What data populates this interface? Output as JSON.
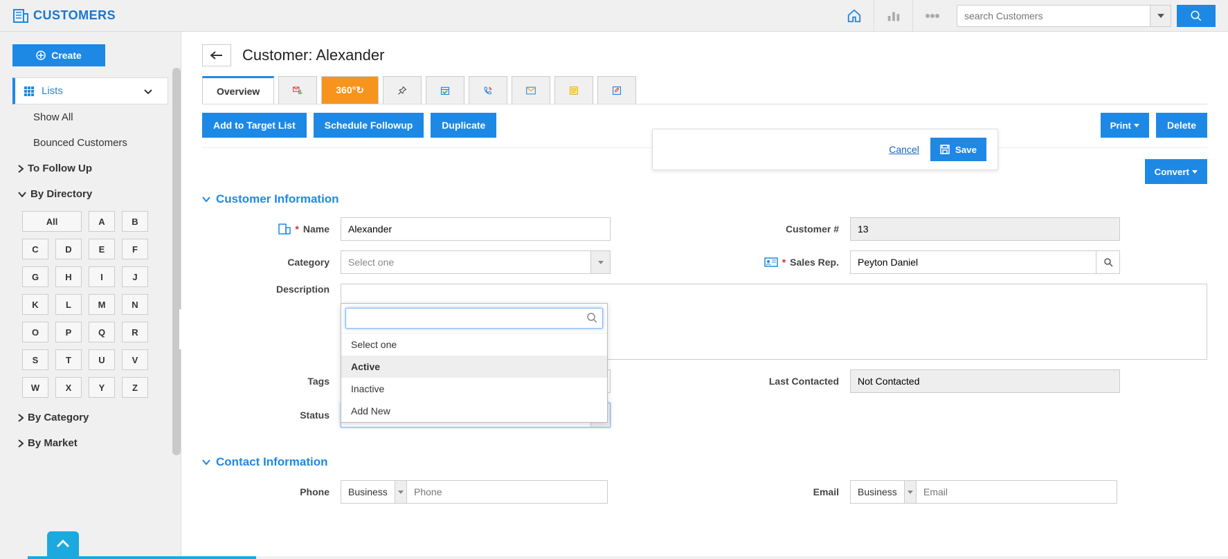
{
  "brand": "CUSTOMERS",
  "search": {
    "placeholder": "search Customers"
  },
  "sidebar": {
    "create": "Create",
    "lists": "Lists",
    "items": [
      "Show All",
      "Bounced Customers"
    ],
    "to_follow": "To Follow Up",
    "by_directory": "By Directory",
    "letters_wide": "All",
    "letters": [
      "A",
      "B",
      "C",
      "D",
      "E",
      "F",
      "G",
      "H",
      "I",
      "J",
      "K",
      "L",
      "M",
      "N",
      "O",
      "P",
      "Q",
      "R",
      "S",
      "T",
      "U",
      "V",
      "W",
      "X",
      "Y",
      "Z"
    ],
    "by_category": "By Category",
    "by_market": "By Market"
  },
  "page": {
    "title": "Customer: Alexander"
  },
  "tabs": {
    "overview": "Overview",
    "orange": "360°↻"
  },
  "actions": {
    "add_target": "Add to Target List",
    "schedule": "Schedule Followup",
    "duplicate": "Duplicate",
    "print": "Print",
    "delete": "Delete",
    "convert": "Convert",
    "cancel": "Cancel",
    "save": "Save"
  },
  "sections": {
    "customer_info": "Customer Information",
    "contact_info": "Contact Information"
  },
  "form": {
    "name_label": "Name",
    "name_value": "Alexander",
    "cust_no_label": "Customer #",
    "cust_no_value": "13",
    "category_label": "Category",
    "category_placeholder": "Select one",
    "sales_label": "Sales Rep.",
    "sales_value": "Peyton Daniel",
    "desc_label": "Description",
    "tags_label": "Tags",
    "last_contact_label": "Last Contacted",
    "last_contact_value": "Not Contacted",
    "status_label": "Status",
    "status_value": "Active",
    "phone_label": "Phone",
    "phone_type": "Business",
    "phone_ph": "Phone",
    "email_label": "Email",
    "email_type": "Business",
    "email_ph": "Email"
  },
  "dropdown": {
    "opt0": "Select one",
    "opt1": "Active",
    "opt2": "Inactive",
    "opt3": "Add New"
  }
}
